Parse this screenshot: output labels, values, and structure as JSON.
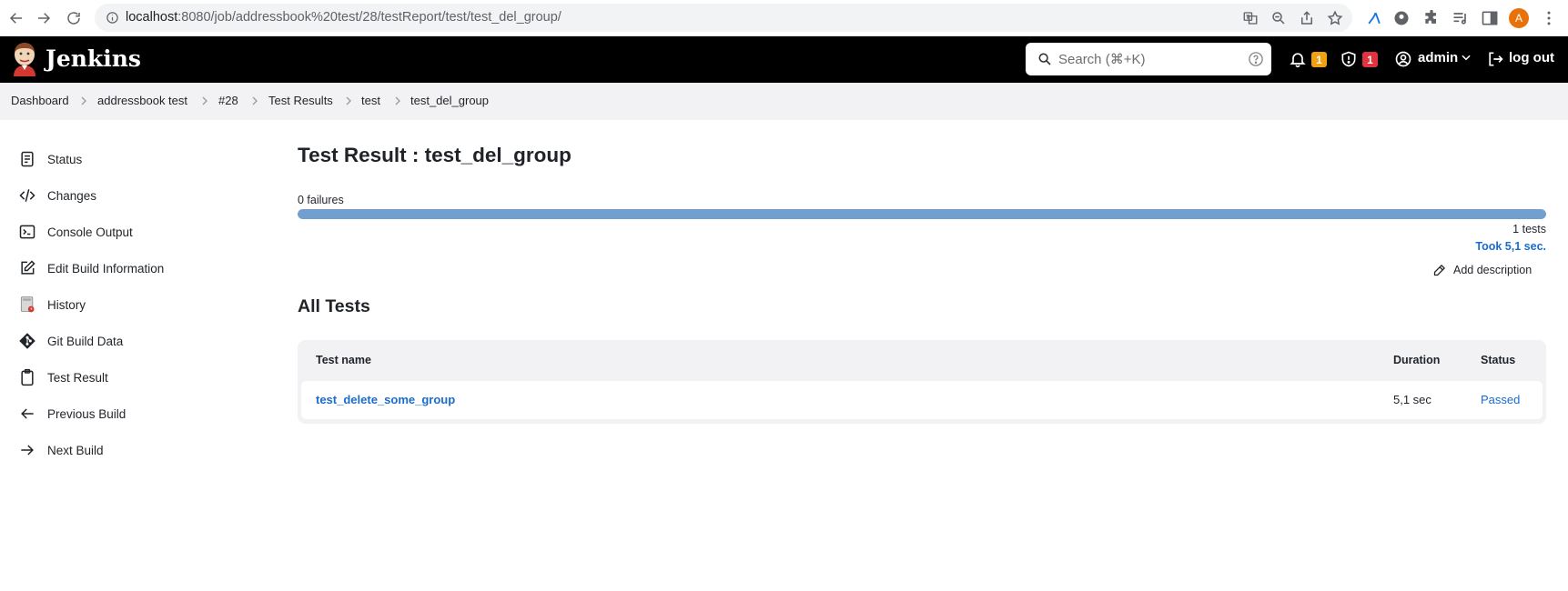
{
  "browser": {
    "url_host": "localhost",
    "url_path": ":8080/job/addressbook%20test/28/testReport/test/test_del_group/",
    "profile_initial": "A"
  },
  "header": {
    "brand": "Jenkins",
    "search_placeholder": "Search (⌘+K)",
    "notifications_count": "1",
    "security_count": "1",
    "user": "admin",
    "logout_label": "log out"
  },
  "breadcrumbs": [
    "Dashboard",
    "addressbook test",
    "#28",
    "Test Results",
    "test",
    "test_del_group"
  ],
  "sidebar": {
    "items": [
      {
        "label": "Status",
        "icon": "document-icon"
      },
      {
        "label": "Changes",
        "icon": "code-icon"
      },
      {
        "label": "Console Output",
        "icon": "terminal-icon"
      },
      {
        "label": "Edit Build Information",
        "icon": "edit-icon"
      },
      {
        "label": "History",
        "icon": "history-icon"
      },
      {
        "label": "Git Build Data",
        "icon": "git-icon"
      },
      {
        "label": "Test Result",
        "icon": "clipboard-icon"
      },
      {
        "label": "Previous Build",
        "icon": "arrow-left-icon"
      },
      {
        "label": "Next Build",
        "icon": "arrow-right-icon"
      }
    ]
  },
  "main": {
    "title": "Test Result : test_del_group",
    "failures": "0 failures",
    "pass_fraction": 1.0,
    "tests_count": "1 tests",
    "took": "Took 5,1 sec.",
    "add_description": "Add description",
    "all_tests_title": "All Tests",
    "table": {
      "headers": [
        "Test name",
        "Duration",
        "Status"
      ],
      "rows": [
        {
          "name": "test_delete_some_group",
          "duration": "5,1 sec",
          "status": "Passed"
        }
      ]
    }
  },
  "colors": {
    "header_bg": "#000000",
    "link": "#1a6ccd",
    "progress_pass": "#729fcf",
    "badge_warn": "#f0a010",
    "badge_danger": "#e0323f"
  }
}
